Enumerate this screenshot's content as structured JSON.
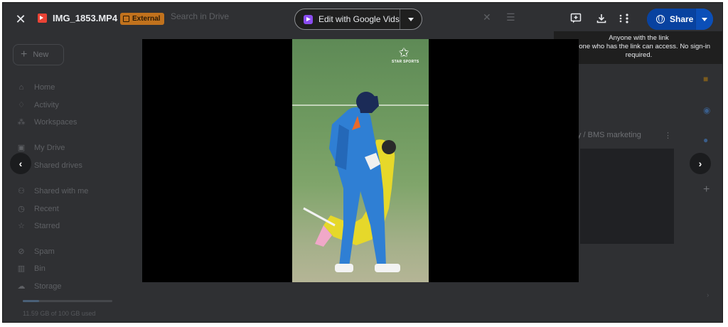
{
  "viewer": {
    "file_name": "IMG_1853.MP4",
    "badge": "External",
    "edit_button": "Edit with Google Vids",
    "share_label": "Share",
    "tooltip_line1": "Anyone with the link",
    "tooltip_line2": "Anyone who has the link can access. No sign-in required."
  },
  "background": {
    "search_placeholder": "Search in Drive",
    "new_label": "New",
    "nav": [
      {
        "label": "Home",
        "icon": "home-icon"
      },
      {
        "label": "Activity",
        "icon": "bell-icon"
      },
      {
        "label": "Workspaces",
        "icon": "workspaces-icon"
      },
      {
        "label": "My Drive",
        "icon": "drive-icon"
      },
      {
        "label": "Shared drives",
        "icon": "shared-drives-icon"
      },
      {
        "label": "Shared with me",
        "icon": "people-icon"
      },
      {
        "label": "Recent",
        "icon": "clock-icon"
      },
      {
        "label": "Starred",
        "icon": "star-icon"
      },
      {
        "label": "Spam",
        "icon": "spam-icon"
      },
      {
        "label": "Bin",
        "icon": "bin-icon"
      },
      {
        "label": "Storage",
        "icon": "cloud-icon"
      }
    ],
    "storage_text": "11.59 GB of 100 GB used",
    "folder_title": "y / BMS marketing"
  },
  "video": {
    "logo_text": "STAR SPORTS"
  },
  "colors": {
    "share_blue": "#0b57d0",
    "external_badge": "#c1721d",
    "vids_purple": "#8a4cf0",
    "file_red": "#ea4335"
  }
}
